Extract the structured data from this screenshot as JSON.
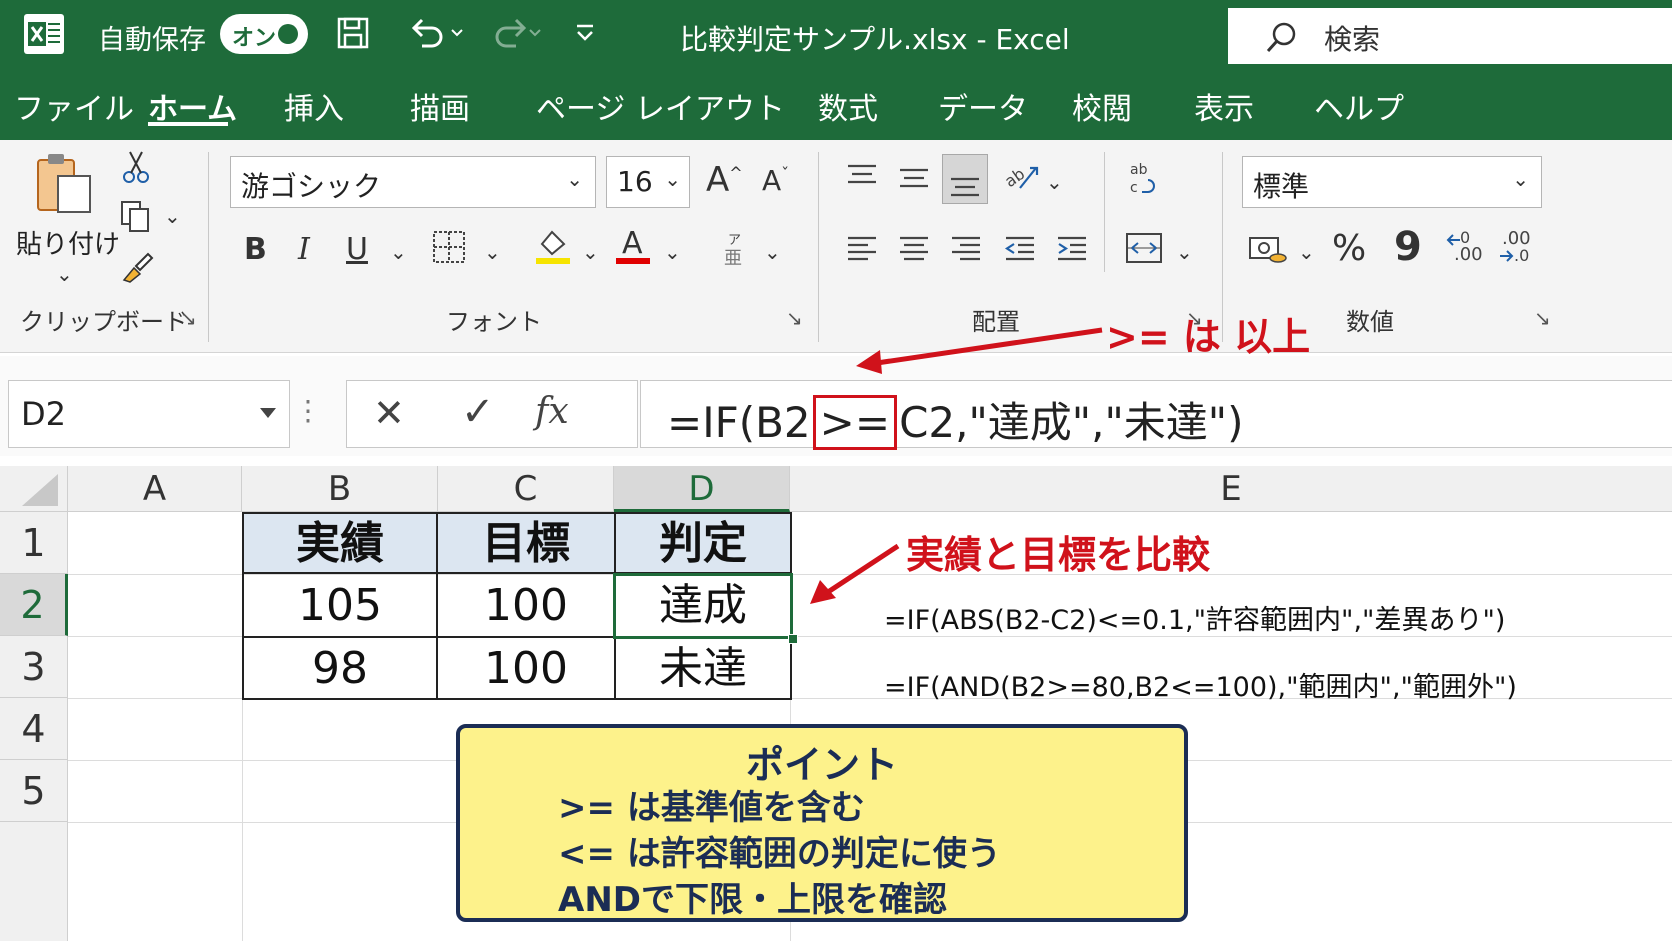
{
  "titlebar": {
    "autosave_label": "自動保存",
    "autosave_toggle": "オン",
    "filename": "比較判定サンプル.xlsx - Excel",
    "search_placeholder": "検索"
  },
  "tabs": [
    "ファイル",
    "ホーム",
    "挿入",
    "描画",
    "ページ レイアウト",
    "数式",
    "データ",
    "校閲",
    "表示",
    "ヘルプ"
  ],
  "active_tab": "ホーム",
  "ribbon": {
    "clipboard": {
      "paste_label": "貼り付け",
      "group_label": "クリップボード"
    },
    "font": {
      "name": "游ゴシック",
      "size": "16",
      "group_label": "フォント",
      "bold": "B",
      "italic": "I",
      "underline": "U",
      "grow": "A",
      "shrink": "A",
      "font_color_letter": "A"
    },
    "alignment": {
      "group_label": "配置"
    },
    "number": {
      "format": "標準",
      "group_label": "数値",
      "percent": "%",
      "comma": "9",
      "inc_decimal": ".00",
      "dec_decimal": ".00"
    }
  },
  "formula_bar": {
    "name_box": "D2",
    "cancel": "✕",
    "enter": "✓",
    "fx": "fx",
    "formula_prefix": "=IF(B2",
    "formula_highlight": ">=",
    "formula_suffix": "C2,\"達成\",\"未達\")"
  },
  "sheet": {
    "columns": [
      "A",
      "B",
      "C",
      "D",
      "E"
    ],
    "rows": [
      "1",
      "2",
      "3",
      "4",
      "5"
    ],
    "cells": {
      "B1": "実績",
      "C1": "目標",
      "D1": "判定",
      "B2": "105",
      "C2": "100",
      "D2": "達成",
      "B3": "98",
      "C3": "100",
      "D3": "未達"
    },
    "notes": {
      "E2": "=IF(ABS(B2-C2)<=0.1,\"許容範囲内\",\"差異あり\")",
      "E3": "=IF(AND(B2>=80,B2<=100),\"範囲内\",\"範囲外\")"
    }
  },
  "annotations": {
    "ge_note": ">= は 以上",
    "compare_note": "実績と目標を比較"
  },
  "point_box": {
    "title": "ポイント",
    "lines": [
      ">= は基準値を含む",
      "<= は許容範囲の判定に使う",
      "ANDで下限・上限を確認"
    ]
  },
  "colors": {
    "excel_green": "#1e6b3a",
    "header_fill": "#dce6f1",
    "annotation_red": "#d0121b",
    "point_fill": "#fdf28b",
    "point_border": "#1b2d55"
  }
}
